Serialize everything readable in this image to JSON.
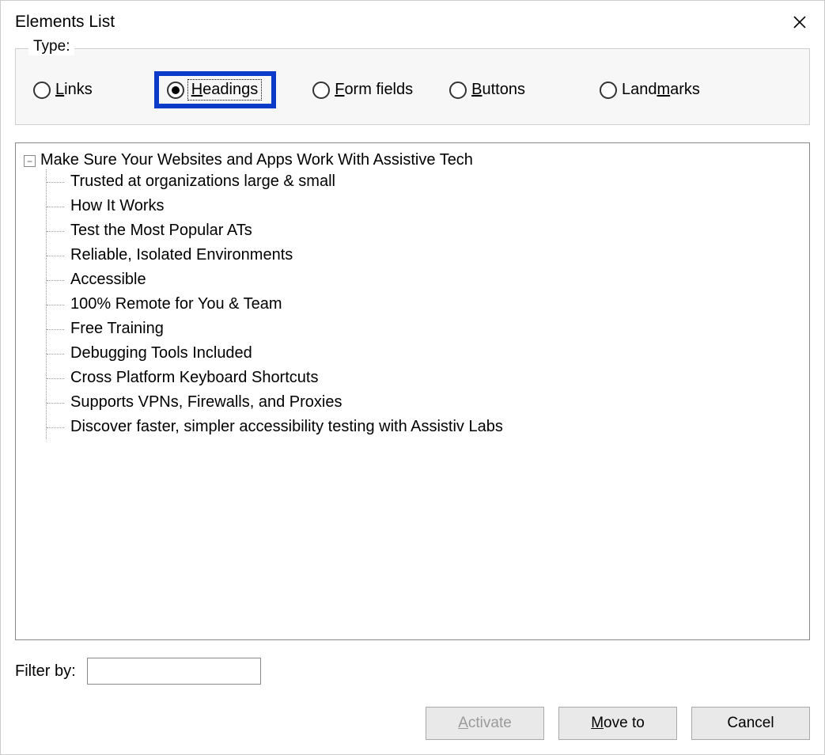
{
  "window": {
    "title": "Elements List"
  },
  "type_group": {
    "legend": "Type:",
    "options": {
      "links": {
        "pre": "",
        "key": "L",
        "post": "inks",
        "checked": false
      },
      "headings": {
        "pre": "",
        "key": "H",
        "post": "eadings",
        "checked": true
      },
      "formfields": {
        "pre": "",
        "key": "F",
        "post": "orm fields",
        "checked": false
      },
      "buttons": {
        "pre": "",
        "key": "B",
        "post": "uttons",
        "checked": false
      },
      "landmarks": {
        "pre": "Land",
        "key": "m",
        "post": "arks",
        "checked": false
      }
    }
  },
  "tree": {
    "root": "Make Sure Your Websites and Apps Work With Assistive Tech",
    "children": [
      "Trusted at organizations large & small",
      "How It Works",
      "Test the Most Popular ATs",
      "Reliable, Isolated Environments",
      "Accessible",
      "100% Remote for You & Team",
      "Free Training",
      "Debugging Tools Included",
      "Cross Platform Keyboard Shortcuts",
      "Supports VPNs, Firewalls, and Proxies",
      "Discover faster, simpler accessibility testing with Assistiv Labs"
    ]
  },
  "filter": {
    "label_pre": "Filter b",
    "label_key": "y",
    "label_post": ":",
    "value": ""
  },
  "buttons": {
    "activate": {
      "pre": "",
      "key": "A",
      "post": "ctivate",
      "disabled": true
    },
    "moveto": {
      "pre": "",
      "key": "M",
      "post": "ove to",
      "disabled": false
    },
    "cancel": {
      "text": "Cancel",
      "disabled": false
    }
  }
}
